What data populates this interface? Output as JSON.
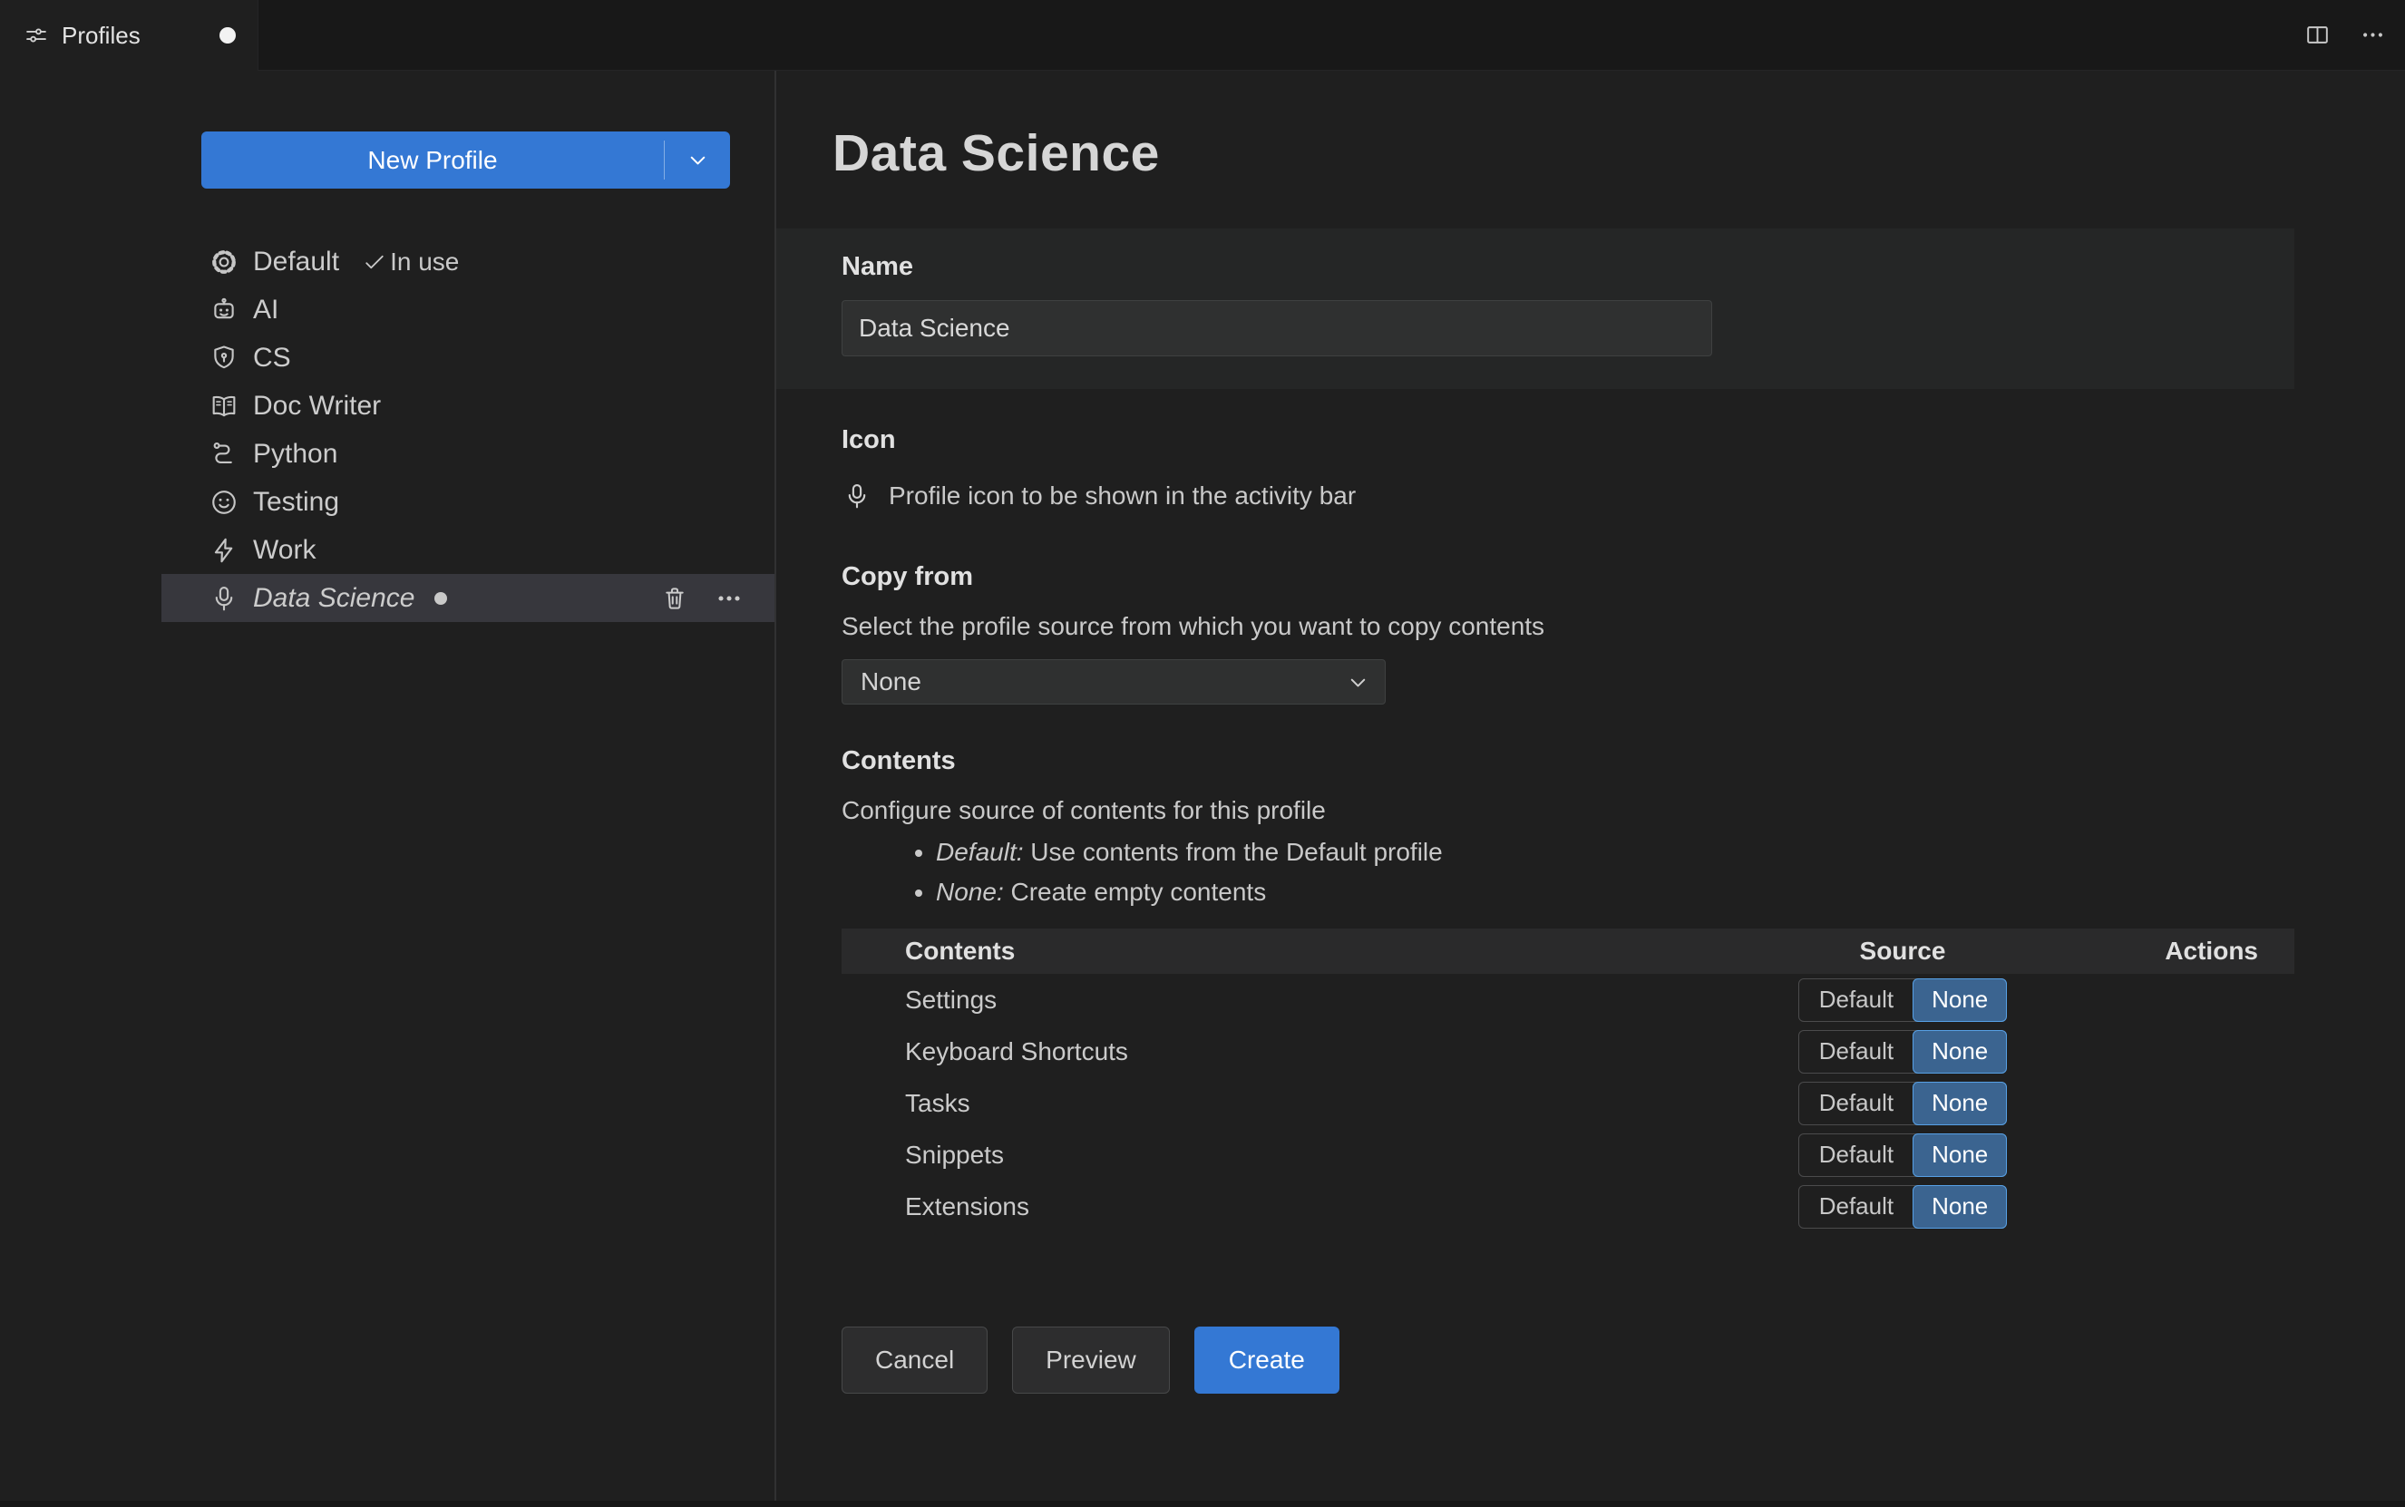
{
  "tab": {
    "title": "Profiles",
    "dirty": true
  },
  "window_actions": {
    "split_editor_icon": "split-editor-icon",
    "more_icon": "ellipsis-icon"
  },
  "sidebar": {
    "new_profile_label": "New Profile",
    "profiles": [
      {
        "name": "Default",
        "icon": "gear",
        "badge": "In use",
        "in_use": true
      },
      {
        "name": "AI",
        "icon": "robot"
      },
      {
        "name": "CS",
        "icon": "shield"
      },
      {
        "name": "Doc Writer",
        "icon": "book"
      },
      {
        "name": "Python",
        "icon": "snake"
      },
      {
        "name": "Testing",
        "icon": "smiley"
      },
      {
        "name": "Work",
        "icon": "zap"
      },
      {
        "name": "Data Science",
        "icon": "mic",
        "selected": true,
        "modified": true
      }
    ]
  },
  "main": {
    "title": "Data Science",
    "name_section": {
      "label": "Name",
      "value": "Data Science"
    },
    "icon_section": {
      "label": "Icon",
      "icon": "mic",
      "description": "Profile icon to be shown in the activity bar"
    },
    "copy_from": {
      "label": "Copy from",
      "description": "Select the profile source from which you want to copy contents",
      "value": "None"
    },
    "contents_section": {
      "label": "Contents",
      "description": "Configure source of contents for this profile",
      "bullets": [
        {
          "term": "Default:",
          "text": " Use contents from the Default profile"
        },
        {
          "term": "None:",
          "text": " Create empty contents"
        }
      ],
      "table": {
        "headers": [
          "Contents",
          "Source",
          "Actions"
        ],
        "toggle_options": [
          "Default",
          "None"
        ],
        "rows": [
          {
            "label": "Settings",
            "source": "None"
          },
          {
            "label": "Keyboard Shortcuts",
            "source": "None"
          },
          {
            "label": "Tasks",
            "source": "None"
          },
          {
            "label": "Snippets",
            "source": "None"
          },
          {
            "label": "Extensions",
            "source": "None"
          }
        ]
      }
    },
    "footer": {
      "cancel": "Cancel",
      "preview": "Preview",
      "create": "Create"
    }
  },
  "colors": {
    "editor_background": "#1f1f1f",
    "tabbar_background": "#181818",
    "accent_blue": "#3478d4",
    "toggle_selected_background": "#3b6490",
    "toggle_selected_border": "#57a0e5",
    "list_selection_background": "#37373d",
    "section_highlight": "#252626",
    "input_background": "#2f3030",
    "text": "#cccccc"
  }
}
